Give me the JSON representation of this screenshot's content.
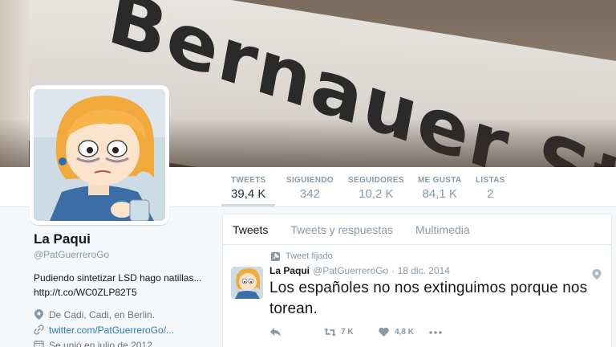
{
  "banner": {
    "sign_text": "Bernauer Straße"
  },
  "profile_nav": {
    "stats": [
      {
        "label": "TWEETS",
        "value": "39,4 K"
      },
      {
        "label": "SIGUIENDO",
        "value": "342"
      },
      {
        "label": "SEGUIDORES",
        "value": "10,2 K"
      },
      {
        "label": "ME GUSTA",
        "value": "84,1 K"
      },
      {
        "label": "LISTAS",
        "value": "2"
      }
    ]
  },
  "profile": {
    "name": "La Paqui",
    "handle": "@PatGuerreroGo",
    "bio_line1": "Pudiendo sintetizar LSD hago natillas...",
    "bio_line2": "http://t.co/WC0ZLP82T5",
    "location": "De Cadi, Cadi, en Berlin.",
    "website": "twitter.com/PatGuerreroGo/...",
    "joined": "Se unió en julio de 2012"
  },
  "timeline": {
    "tabs": [
      "Tweets",
      "Tweets y respuestas",
      "Multimedia"
    ],
    "pinned_label": "Tweet fijado",
    "tweet": {
      "name": "La Paqui",
      "handle": "@PatGuerreroGo",
      "date": "· 18 dic. 2014",
      "text": "Los españoles no nos extinguimos porque nos torean.",
      "retweets": "7 K",
      "likes": "4,8 K"
    }
  },
  "colors": {
    "link": "#2b7bb9",
    "muted": "#8899a6",
    "background": "#f5f8fa"
  }
}
